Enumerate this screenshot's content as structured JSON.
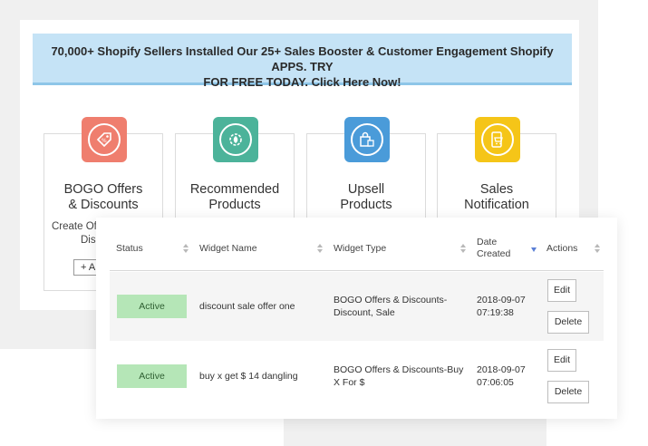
{
  "banner": {
    "text_line1": "70,000+ Shopify Sellers Installed Our 25+ Sales Booster & Customer Engagement Shopify APPS. TRY",
    "text_line2": "FOR FREE TODAY. Click Here Now!"
  },
  "apps": [
    {
      "icon": "percent-tag-icon",
      "color": "#ef7e6e",
      "title_line1": "BOGO Offers",
      "title_line2": "& Discounts",
      "desc_line1": "Create Of",
      "desc_line2": "Dis",
      "add_label": "+ A"
    },
    {
      "icon": "gear-leaf-icon",
      "color": "#4cb39a",
      "title_line1": "Recommended",
      "title_line2": "Products"
    },
    {
      "icon": "shopping-bag-icon",
      "color": "#4a9bd9",
      "title_line1": "Upsell",
      "title_line2": "Products"
    },
    {
      "icon": "phone-cart-icon",
      "color": "#f5c518",
      "title_line1": "Sales",
      "title_line2": "Notification"
    }
  ],
  "table": {
    "headers": {
      "status": "Status",
      "widget_name": "Widget Name",
      "widget_type": "Widget Type",
      "date_line1": "Date",
      "date_line2": "Created",
      "actions": "Actions"
    },
    "rows": [
      {
        "status": "Active",
        "name": "discount sale offer one",
        "type_line1": "BOGO Offers & Discounts-",
        "type_line2": "Discount, Sale",
        "date": "2018-09-07",
        "time": "07:19:38",
        "edit": "Edit",
        "delete": "Delete"
      },
      {
        "status": "Active",
        "name": "buy x get $ 14 dangling",
        "type_line1": "BOGO Offers & Discounts-Buy",
        "type_line2": "X For $",
        "date": "2018-09-07",
        "time": "07:06:05",
        "edit": "Edit",
        "delete": "Delete"
      }
    ]
  }
}
